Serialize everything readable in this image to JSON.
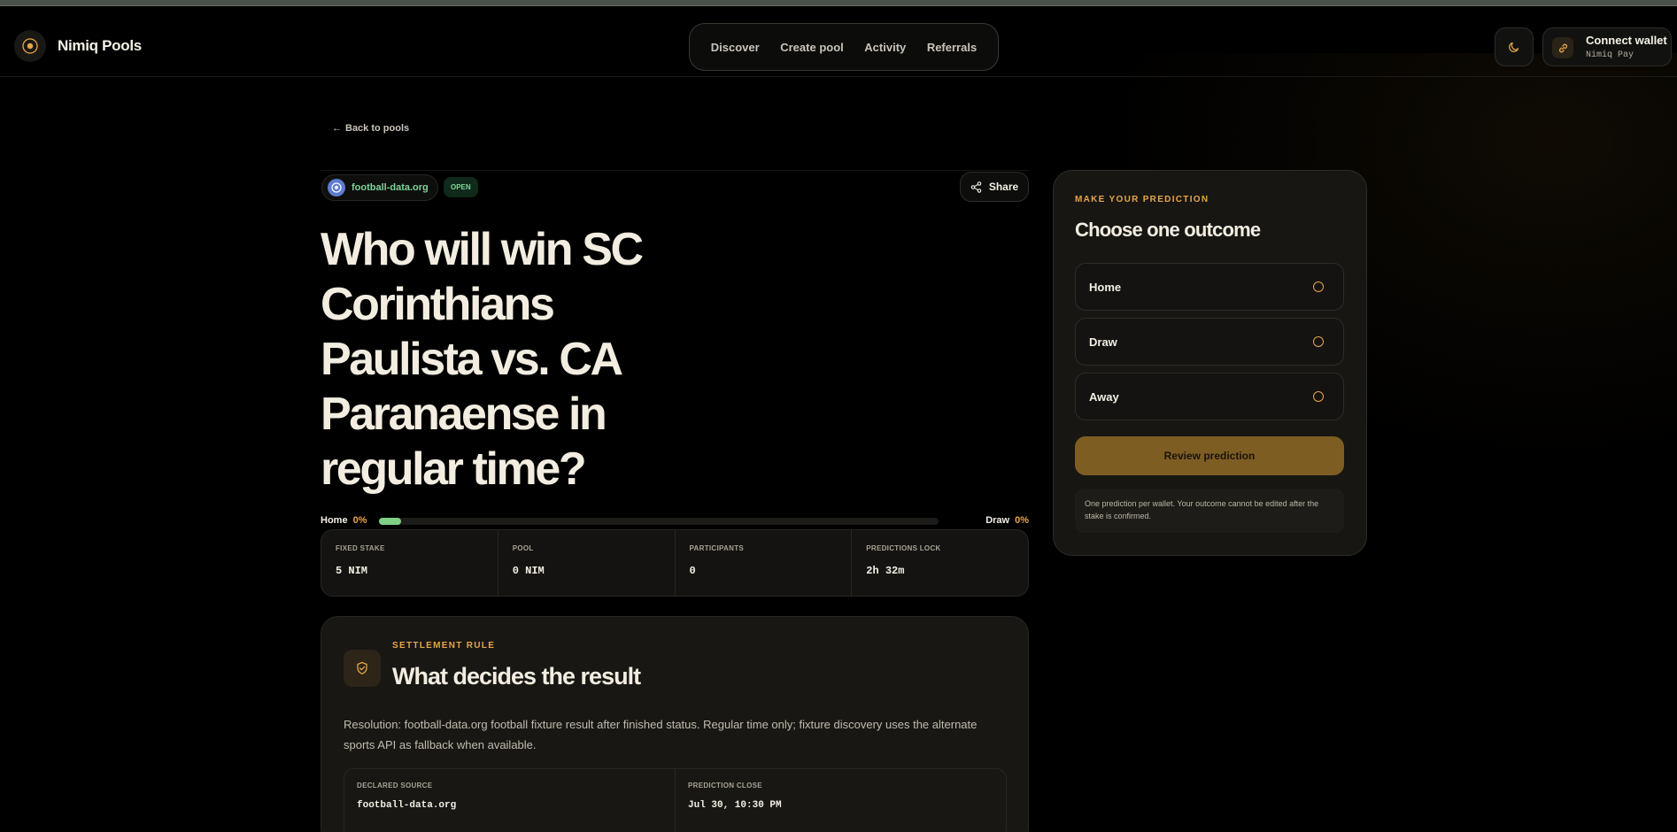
{
  "header": {
    "brand": "Nimiq Pools",
    "nav": [
      "Discover",
      "Create pool",
      "Activity",
      "Referrals"
    ],
    "wallet_title": "Connect wallet",
    "wallet_subtitle": "Nimiq Pay"
  },
  "back_label": "Back to pools",
  "pool": {
    "source": "football-data.org",
    "status": "OPEN",
    "share_label": "Share",
    "title": "Who will win SC Corinthians Paulista vs. CA Paranaense in regular time?",
    "odds": {
      "left_label": "Home",
      "left_pct": "0%",
      "right_label": "Draw",
      "right_pct": "0%",
      "fill_fraction": 0.04
    },
    "stats": [
      {
        "label": "FIXED STAKE",
        "value": "5 NIM"
      },
      {
        "label": "POOL",
        "value": "0 NIM"
      },
      {
        "label": "PARTICIPANTS",
        "value": "0"
      },
      {
        "label": "PREDICTIONS LOCK",
        "value": "2h 32m"
      }
    ]
  },
  "settlement": {
    "eyebrow": "SETTLEMENT RULE",
    "title": "What decides the result",
    "description": "Resolution: football-data.org football fixture result after finished status. Regular time only; fixture discovery uses the alternate sports API as fallback when available.",
    "fields": [
      {
        "label": "DECLARED SOURCE",
        "value": "football-data.org"
      },
      {
        "label": "PREDICTION CLOSE",
        "value": "Jul 30, 10:30 PM"
      }
    ]
  },
  "prediction": {
    "eyebrow": "MAKE YOUR PREDICTION",
    "title": "Choose one outcome",
    "options": [
      "Home",
      "Draw",
      "Away"
    ],
    "review_label": "Review prediction",
    "note": "One prediction per wallet. Your outcome cannot be edited after the stake is confirmed."
  },
  "colors": {
    "accent": "#e8a54a",
    "success": "#7fd49a",
    "background": "#000000",
    "card": "#171613"
  }
}
